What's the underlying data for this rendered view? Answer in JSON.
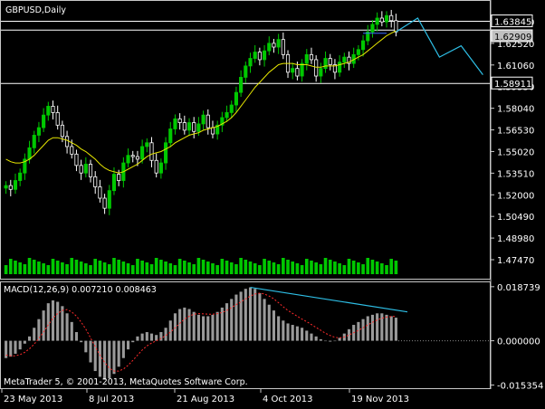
{
  "window": {
    "symbol_title": "GBPUSD,Daily",
    "copyright": "MetaTrader 5, © 2001-2013, MetaQuotes Software Corp."
  },
  "colors": {
    "background": "#000000",
    "frame": "#c8c8c8",
    "bull_candle": "#00c800",
    "bear_candle": "#ffffff",
    "moving_average": "#e6e600",
    "trendline": "#2ebfe6",
    "macd_histogram": "#9a9a9a",
    "macd_signal": "#ff2a2a",
    "volume": "#00c800",
    "horizontal_lines": "#ffffff",
    "price_label_bg": "#000000",
    "current_price_label_bg": "#c0c0c0"
  },
  "indicator": {
    "macd_title": "MACD(12,26,9) 0.007210 0.008463"
  },
  "chart_data": [
    {
      "type": "candlestick",
      "title": "GBPUSD,Daily",
      "ylim": [
        1.447,
        1.6525
      ],
      "price_axis_ticks": [
        "1.64030",
        "1.62520",
        "1.61060",
        "1.59550",
        "1.58040",
        "1.56530",
        "1.55020",
        "1.53510",
        "1.52000",
        "1.50490",
        "1.48980",
        "1.47470"
      ],
      "price_labels": [
        "1.63845",
        "1.62909",
        "1.58911"
      ],
      "horizontal_levels": [
        1.63845,
        1.6315,
        1.58911
      ],
      "x_tick_labels": [
        "23 May 2013",
        "8 Jul 2013",
        "21 Aug 2013",
        "4 Oct 2013",
        "19 Nov 2013"
      ],
      "close_series": [
        1.508,
        1.505,
        1.512,
        1.518,
        1.529,
        1.538,
        1.548,
        1.554,
        1.564,
        1.571,
        1.566,
        1.556,
        1.547,
        1.539,
        1.533,
        1.524,
        1.518,
        1.525,
        1.515,
        1.507,
        1.498,
        1.49,
        1.504,
        1.517,
        1.512,
        1.526,
        1.532,
        1.531,
        1.529,
        1.539,
        1.542,
        1.528,
        1.518,
        1.526,
        1.542,
        1.553,
        1.561,
        1.558,
        1.552,
        1.558,
        1.551,
        1.557,
        1.564,
        1.554,
        1.549,
        1.556,
        1.562,
        1.566,
        1.572,
        1.582,
        1.594,
        1.603,
        1.609,
        1.614,
        1.608,
        1.615,
        1.621,
        1.618,
        1.624,
        1.612,
        1.598,
        1.601,
        1.595,
        1.605,
        1.612,
        1.608,
        1.595,
        1.601,
        1.609,
        1.604,
        1.598,
        1.606,
        1.61,
        1.605,
        1.612,
        1.616,
        1.623,
        1.63,
        1.636,
        1.641,
        1.638,
        1.643,
        1.639,
        1.63
      ],
      "moving_average_series": [
        1.529,
        1.527,
        1.526,
        1.526,
        1.527,
        1.529,
        1.532,
        1.536,
        1.54,
        1.544,
        1.546,
        1.546,
        1.545,
        1.544,
        1.542,
        1.54,
        1.537,
        1.535,
        1.532,
        1.529,
        1.525,
        1.522,
        1.52,
        1.519,
        1.518,
        1.519,
        1.521,
        1.523,
        1.525,
        1.528,
        1.531,
        1.533,
        1.534,
        1.535,
        1.537,
        1.539,
        1.542,
        1.544,
        1.546,
        1.548,
        1.549,
        1.55,
        1.552,
        1.553,
        1.554,
        1.555,
        1.557,
        1.559,
        1.562,
        1.566,
        1.571,
        1.576,
        1.581,
        1.586,
        1.59,
        1.594,
        1.598,
        1.601,
        1.604,
        1.605,
        1.605,
        1.605,
        1.604,
        1.604,
        1.604,
        1.603,
        1.602,
        1.602,
        1.603,
        1.603,
        1.603,
        1.604,
        1.605,
        1.606,
        1.608,
        1.61,
        1.612,
        1.615,
        1.618,
        1.621,
        1.624,
        1.627,
        1.629,
        1.631
      ],
      "projection_series": [
        1.63,
        1.641,
        1.61,
        1.619,
        1.596
      ],
      "grid": false
    },
    {
      "type": "histogram",
      "title": "MACD(12,26,9) 0.007210 0.008463",
      "ylim": [
        -0.0155,
        0.019
      ],
      "axis_ticks": [
        "0.018739",
        "0.000000",
        "-0.015354"
      ],
      "macd_values": [
        -0.006,
        -0.0055,
        -0.0045,
        -0.003,
        -0.001,
        0.0015,
        0.0045,
        0.0075,
        0.0105,
        0.013,
        0.014,
        0.0135,
        0.012,
        0.0095,
        0.0065,
        0.003,
        -0.0005,
        -0.004,
        -0.0075,
        -0.0105,
        -0.0125,
        -0.0135,
        -0.013,
        -0.0115,
        -0.009,
        -0.006,
        -0.003,
        -0.0005,
        0.0015,
        0.0025,
        0.003,
        0.0025,
        0.002,
        0.003,
        0.0045,
        0.007,
        0.0095,
        0.011,
        0.0115,
        0.011,
        0.01,
        0.009,
        0.0085,
        0.0085,
        0.009,
        0.01,
        0.0115,
        0.013,
        0.0145,
        0.016,
        0.017,
        0.018,
        0.0185,
        0.018,
        0.0165,
        0.0145,
        0.0125,
        0.0105,
        0.0085,
        0.007,
        0.006,
        0.0055,
        0.005,
        0.0045,
        0.0035,
        0.0025,
        0.0015,
        0.0005,
        0.0,
        -0.0003,
        0.0,
        0.001,
        0.0025,
        0.004,
        0.0055,
        0.0065,
        0.0075,
        0.0085,
        0.009,
        0.0095,
        0.0095,
        0.009,
        0.0085,
        0.008
      ],
      "signal_values": [
        -0.005,
        -0.0052,
        -0.0052,
        -0.0048,
        -0.004,
        -0.0028,
        -0.0012,
        0.0008,
        0.003,
        0.0055,
        0.0078,
        0.0095,
        0.0105,
        0.0108,
        0.01,
        0.0085,
        0.0065,
        0.004,
        0.001,
        -0.002,
        -0.005,
        -0.0075,
        -0.0095,
        -0.0105,
        -0.0105,
        -0.0098,
        -0.0085,
        -0.0068,
        -0.005,
        -0.0032,
        -0.0018,
        -0.0008,
        0.0,
        0.0008,
        0.0018,
        0.003,
        0.0045,
        0.006,
        0.0075,
        0.0085,
        0.0092,
        0.0094,
        0.0093,
        0.0092,
        0.0092,
        0.0094,
        0.0098,
        0.0105,
        0.0115,
        0.0125,
        0.0135,
        0.0145,
        0.0155,
        0.0162,
        0.0165,
        0.0162,
        0.0155,
        0.0145,
        0.0132,
        0.0118,
        0.0105,
        0.0095,
        0.0085,
        0.0075,
        0.0066,
        0.0056,
        0.0046,
        0.0036,
        0.0026,
        0.0018,
        0.0012,
        0.001,
        0.0013,
        0.002,
        0.0028,
        0.0036,
        0.0045,
        0.0055,
        0.0064,
        0.0072,
        0.0078,
        0.0082,
        0.0084,
        0.0085
      ],
      "divergence_line": [
        0.0185,
        0.01
      ]
    }
  ]
}
